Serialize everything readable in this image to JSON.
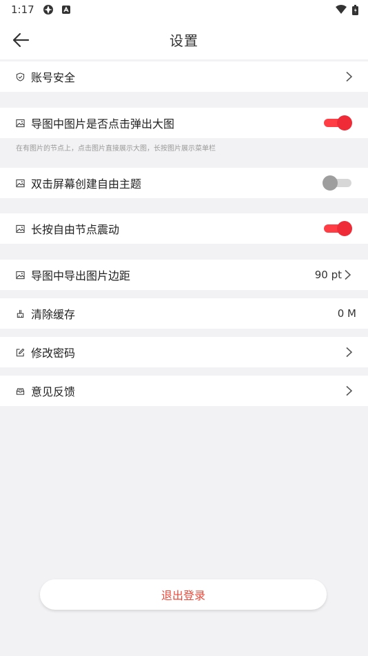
{
  "status_bar": {
    "time": "1:17"
  },
  "header": {
    "title": "设置"
  },
  "rows": {
    "account_security": {
      "label": "账号安全"
    },
    "image_popup": {
      "label": "导图中图片是否点击弹出大图",
      "enabled": true,
      "helper": "在有图片的节点上，点击图片直接展示大图，长按图片展示菜单栏"
    },
    "double_tap_topic": {
      "label": "双击屏幕创建自由主题",
      "enabled": false
    },
    "long_press_vibrate": {
      "label": "长按自由节点震动",
      "enabled": true
    },
    "export_margin": {
      "label": "导图中导出图片边距",
      "value": "90 pt"
    },
    "clear_cache": {
      "label": "清除缓存",
      "value": "0 M"
    },
    "change_password": {
      "label": "修改密码"
    },
    "feedback": {
      "label": "意见反馈"
    }
  },
  "logout": {
    "label": "退出登录"
  },
  "colors": {
    "accent": "#ef2b38",
    "logout_text": "#e84a3b",
    "background": "#f2f2f4"
  }
}
